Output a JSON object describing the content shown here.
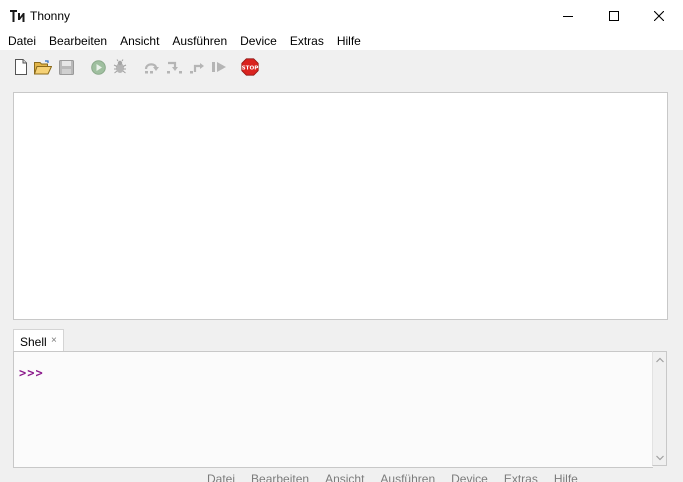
{
  "window": {
    "title": "Thonny",
    "controls": [
      "minimize-icon",
      "maximize-icon",
      "close-icon"
    ]
  },
  "menu": {
    "items": [
      "Datei",
      "Bearbeiten",
      "Ansicht",
      "Ausführen",
      "Device",
      "Extras",
      "Hilfe"
    ]
  },
  "toolbar": {
    "buttons": [
      {
        "name": "new-file-icon",
        "enabled": true
      },
      {
        "name": "open-folder-icon",
        "enabled": true
      },
      {
        "name": "save-icon",
        "enabled": false
      },
      {
        "name": "run-icon",
        "enabled": false
      },
      {
        "name": "debug-bug-icon",
        "enabled": false
      },
      {
        "name": "step-over-icon",
        "enabled": false
      },
      {
        "name": "step-into-icon",
        "enabled": false
      },
      {
        "name": "step-out-icon",
        "enabled": false
      },
      {
        "name": "resume-icon",
        "enabled": false
      },
      {
        "name": "stop-icon",
        "enabled": true
      }
    ],
    "stop_label": "STOP"
  },
  "shell": {
    "tab_label": "Shell",
    "tab_close": "×",
    "prompt": ">>>"
  },
  "background_window": {
    "menu_fragment": [
      "Datei",
      "Bearbeiten",
      "Ansicht",
      "Ausführen",
      "Device",
      "Extras",
      "Hilfe"
    ]
  },
  "colors": {
    "prompt": "#8b1a8b",
    "stop": "#d9231f",
    "run_disabled": "#9fbf9f",
    "chrome": "#f0f0f0"
  }
}
